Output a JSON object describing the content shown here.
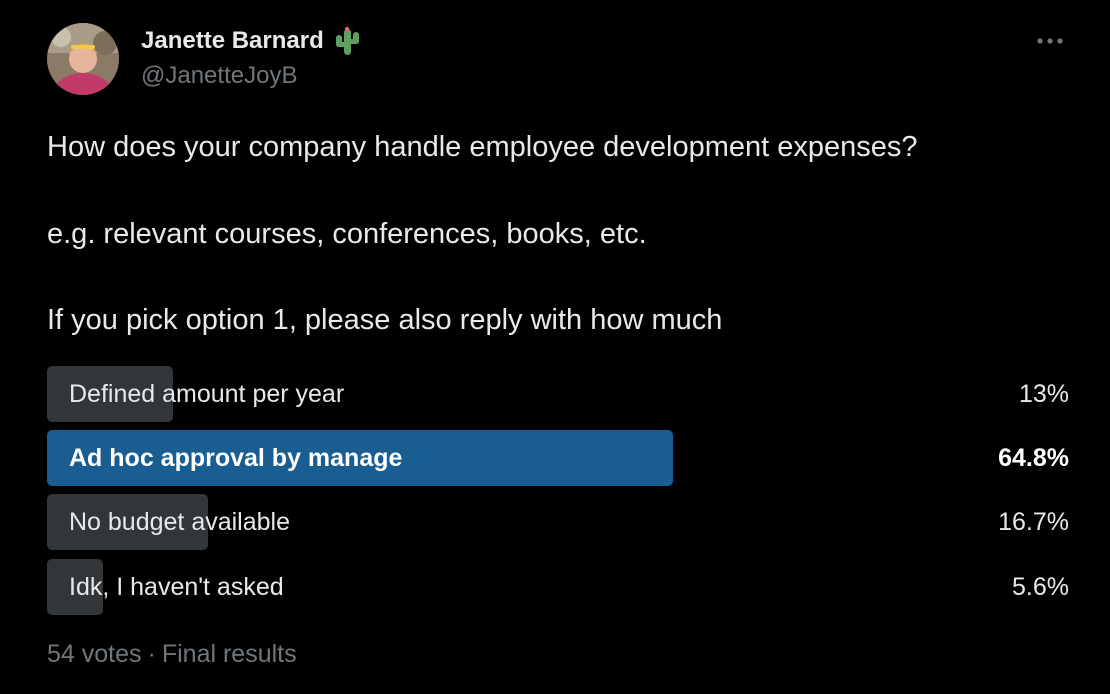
{
  "author": {
    "name": "Janette Barnard",
    "handle": "@JanetteJoyB",
    "name_emoji": "cactus-icon",
    "avatar": "profile-photo"
  },
  "tweet": {
    "lines": [
      "How does your company handle employee development expenses?",
      "e.g. relevant courses, conferences, books, etc.",
      "If you pick option 1, please also reply with how much"
    ]
  },
  "poll": {
    "options": [
      {
        "label": "Defined amount per year",
        "percent_text": "13%",
        "percent": 13.0,
        "winner": false
      },
      {
        "label": "Ad hoc approval by manage",
        "percent_text": "64.8%",
        "percent": 64.8,
        "winner": true
      },
      {
        "label": "No budget available",
        "percent_text": "16.7%",
        "percent": 16.7,
        "winner": false
      },
      {
        "label": "Idk, I haven't asked",
        "percent_text": "5.6%",
        "percent": 5.6,
        "winner": false
      }
    ],
    "votes": "54 votes",
    "separator": "·",
    "status": "Final results"
  },
  "colors": {
    "background": "#000000",
    "text_primary": "#e7e9ea",
    "text_secondary": "#71767b",
    "bar_default": "#333639",
    "bar_winner": "#1a5e91",
    "cactus": "#5fa05f"
  },
  "icons": {
    "more": "more-horizontal-icon"
  }
}
